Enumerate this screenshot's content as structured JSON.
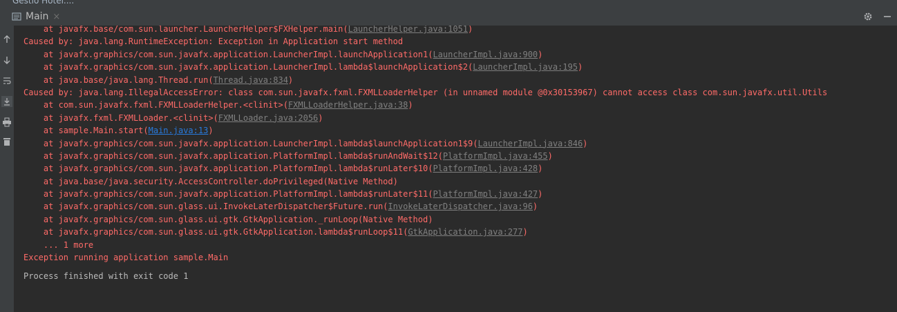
{
  "window": {
    "title": "Gestio Hotel...."
  },
  "tab": {
    "label": "Main",
    "icon": "console-icon",
    "close": "×"
  },
  "toolbar_icons": [
    "rerun-icon",
    "down-arrow-icon",
    "soft-wrap-icon",
    "scroll-to-end-icon",
    "print-icon",
    "trash-icon"
  ],
  "colors": {
    "background": "#2b2b2b",
    "error_text": "#ff6b68",
    "plain_text": "#bbbbbb",
    "link": "#287bde",
    "muted_link": "#808080",
    "toolbar": "#3c3f41"
  },
  "console": {
    "lines": [
      {
        "indent": 1,
        "pre": "at javafx.base/com.sun.launcher.LauncherHelper$FXHelper.main(",
        "link": "LauncherHelper.java:1051",
        "post": ")"
      },
      {
        "indent": 0,
        "pre": "Caused by: java.lang.RuntimeException: Exception in Application start method",
        "link": "",
        "post": ""
      },
      {
        "indent": 1,
        "pre": "at javafx.graphics/com.sun.javafx.application.LauncherImpl.launchApplication1(",
        "link": "LauncherImpl.java:900",
        "post": ")"
      },
      {
        "indent": 1,
        "pre": "at javafx.graphics/com.sun.javafx.application.LauncherImpl.lambda$launchApplication$2(",
        "link": "LauncherImpl.java:195",
        "post": ")"
      },
      {
        "indent": 1,
        "pre": "at java.base/java.lang.Thread.run(",
        "link": "Thread.java:834",
        "post": ")"
      },
      {
        "indent": 0,
        "pre": "Caused by: java.lang.IllegalAccessError: class com.sun.javafx.fxml.FXMLLoaderHelper (in unnamed module @0x30153967) cannot access class com.sun.javafx.util.Utils",
        "link": "",
        "post": ""
      },
      {
        "indent": 1,
        "pre": "at com.sun.javafx.fxml.FXMLLoaderHelper.<clinit>(",
        "link": "FXMLLoaderHelper.java:38",
        "post": ")"
      },
      {
        "indent": 1,
        "pre": "at javafx.fxml.FXMLLoader.<clinit>(",
        "link": "FXMLLoader.java:2056",
        "post": ")"
      },
      {
        "indent": 1,
        "pre": "at sample.Main.start(",
        "link": "Main.java:13",
        "post": ")",
        "link_style": "blue"
      },
      {
        "indent": 1,
        "pre": "at javafx.graphics/com.sun.javafx.application.LauncherImpl.lambda$launchApplication1$9(",
        "link": "LauncherImpl.java:846",
        "post": ")"
      },
      {
        "indent": 1,
        "pre": "at javafx.graphics/com.sun.javafx.application.PlatformImpl.lambda$runAndWait$12(",
        "link": "PlatformImpl.java:455",
        "post": ")"
      },
      {
        "indent": 1,
        "pre": "at javafx.graphics/com.sun.javafx.application.PlatformImpl.lambda$runLater$10(",
        "link": "PlatformImpl.java:428",
        "post": ")"
      },
      {
        "indent": 1,
        "pre": "at java.base/java.security.AccessController.doPrivileged(Native Method)",
        "link": "",
        "post": ""
      },
      {
        "indent": 1,
        "pre": "at javafx.graphics/com.sun.javafx.application.PlatformImpl.lambda$runLater$11(",
        "link": "PlatformImpl.java:427",
        "post": ")"
      },
      {
        "indent": 1,
        "pre": "at javafx.graphics/com.sun.glass.ui.InvokeLaterDispatcher$Future.run(",
        "link": "InvokeLaterDispatcher.java:96",
        "post": ")"
      },
      {
        "indent": 1,
        "pre": "at javafx.graphics/com.sun.glass.ui.gtk.GtkApplication._runLoop(Native Method)",
        "link": "",
        "post": ""
      },
      {
        "indent": 1,
        "pre": "at javafx.graphics/com.sun.glass.ui.gtk.GtkApplication.lambda$runLoop$11(",
        "link": "GtkApplication.java:277",
        "post": ")"
      },
      {
        "indent": 1,
        "pre": "... 1 more",
        "link": "",
        "post": ""
      },
      {
        "indent": 0,
        "pre": "Exception running application sample.Main",
        "link": "",
        "post": ""
      }
    ],
    "footer": "Process finished with exit code 1"
  }
}
